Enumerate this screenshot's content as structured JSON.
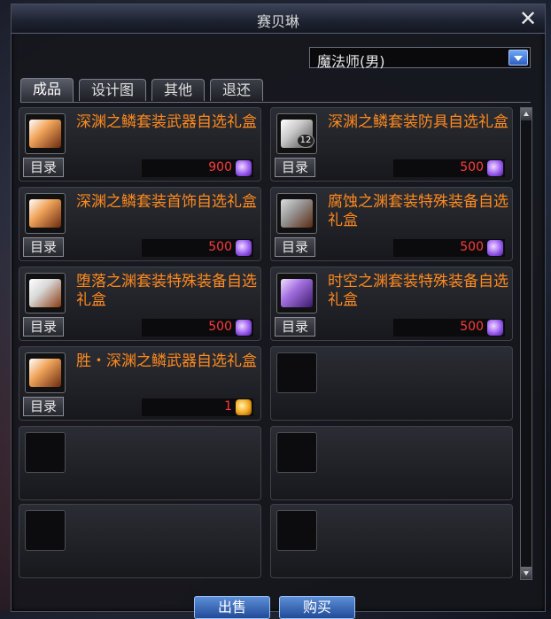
{
  "window": {
    "title": "赛贝琳",
    "close_label": "✕"
  },
  "job_select": {
    "value": "魔法师(男)"
  },
  "tabs": [
    {
      "label": "成品",
      "active": true
    },
    {
      "label": "设计图",
      "active": false
    },
    {
      "label": "其他",
      "active": false
    },
    {
      "label": "退还",
      "active": false
    }
  ],
  "catalog_label": "目录",
  "items": [
    {
      "name": "深渊之鳞套装武器自选礼盒",
      "price": "900",
      "currency": "purple-crystal",
      "box_color": "#f0a45a",
      "badge": ""
    },
    {
      "name": "深渊之鳞套装防具自选礼盒",
      "price": "500",
      "currency": "purple-crystal",
      "box_color": "#c9c9c9",
      "badge": "12"
    },
    {
      "name": "深渊之鳞套装首饰自选礼盒",
      "price": "500",
      "currency": "purple-crystal",
      "box_color": "#f0a45a",
      "badge": ""
    },
    {
      "name": "腐蚀之渊套装特殊装备自选礼盒",
      "price": "500",
      "currency": "purple-crystal",
      "box_color": "#9a9a9a",
      "badge": ""
    },
    {
      "name": "堕落之渊套装特殊装备自选礼盒",
      "price": "500",
      "currency": "purple-crystal",
      "box_color": "#d8d8d8",
      "badge": ""
    },
    {
      "name": "时空之渊套装特殊装备自选礼盒",
      "price": "500",
      "currency": "purple-crystal",
      "box_color": "#a470e0",
      "badge": ""
    },
    {
      "name": "胜・深渊之鳞武器自选礼盒",
      "price": "1",
      "currency": "gold-crystal",
      "box_color": "#f0a45a",
      "badge": ""
    }
  ],
  "buttons": {
    "sell": "出售",
    "buy": "购买"
  }
}
